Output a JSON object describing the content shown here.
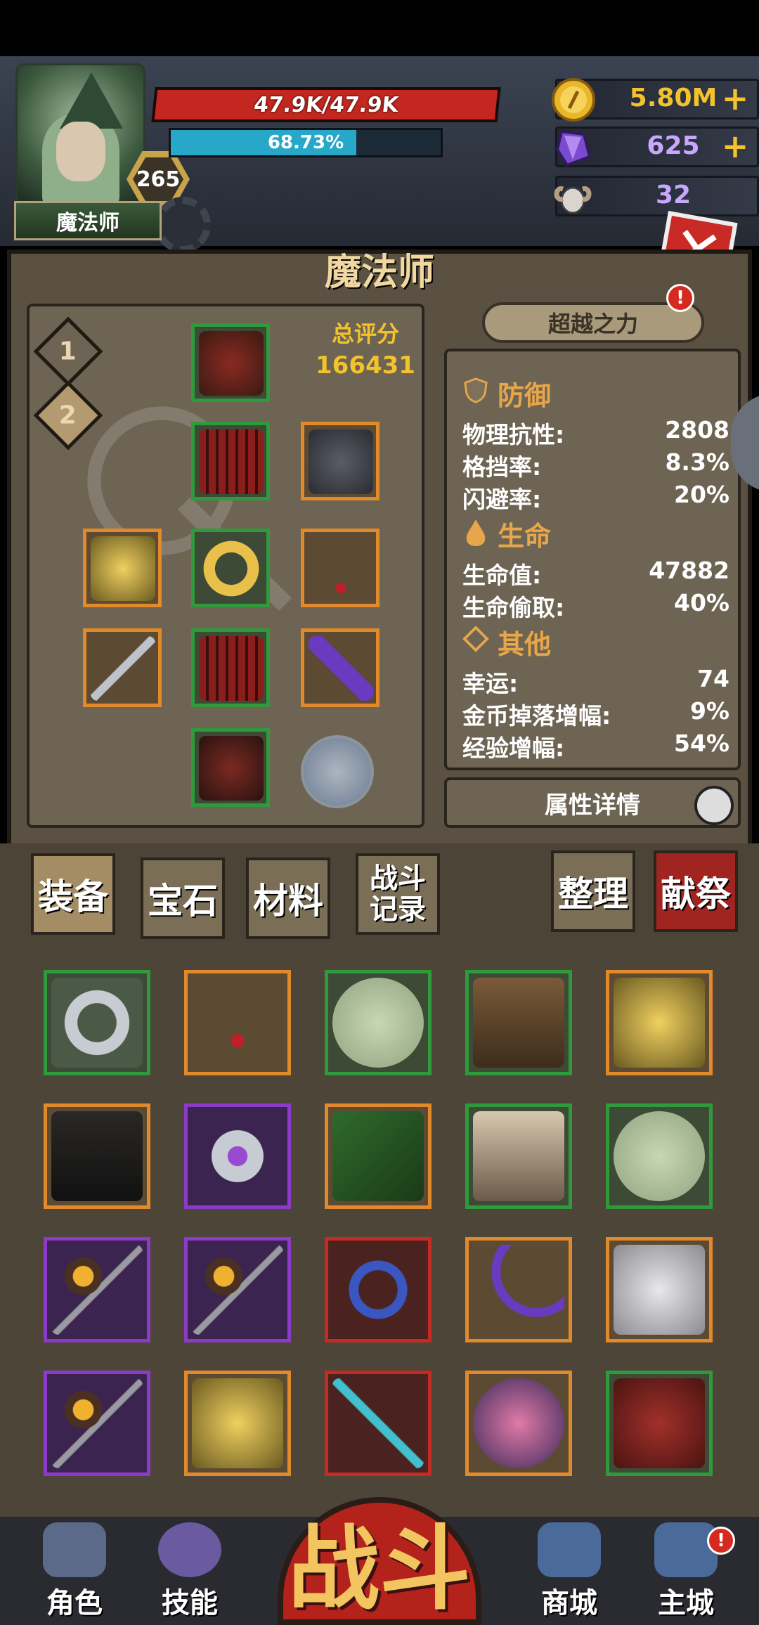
{
  "hero": {
    "class_name": "魔法师",
    "level": "265",
    "hp_text": "47.9K/47.9K",
    "mp_text": "68.73%",
    "mp_fraction": 0.6873
  },
  "currencies": [
    {
      "icon": "gold-coin-icon",
      "value": "5.80M",
      "has_plus": true
    },
    {
      "icon": "purple-crystal-icon",
      "value": "625",
      "has_plus": true
    },
    {
      "icon": "ram-skull-icon",
      "value": "32",
      "has_plus": false
    }
  ],
  "panel": {
    "title": "魔法师",
    "loadout_tabs": [
      "1",
      "2"
    ],
    "score_label": "总评分",
    "score_value": "166431",
    "transcend_label": "超越之力",
    "transcend_badge": "!",
    "detail_button": "属性详情"
  },
  "stats": {
    "defense": {
      "title": "防御",
      "rows": [
        {
          "label": "物理抗性:",
          "value": "2808"
        },
        {
          "label": "格挡率:",
          "value": "8.3%"
        },
        {
          "label": "闪避率:",
          "value": "20%"
        }
      ]
    },
    "life": {
      "title": "生命",
      "rows": [
        {
          "label": "生命值:",
          "value": "47882"
        },
        {
          "label": "生命偷取:",
          "value": "40%"
        }
      ]
    },
    "other": {
      "title": "其他",
      "rows": [
        {
          "label": "幸运:",
          "value": "74"
        },
        {
          "label": "金币掉落增幅:",
          "value": "9%"
        },
        {
          "label": "经验增幅:",
          "value": "54%"
        }
      ]
    }
  },
  "tabs": {
    "equip": "装备",
    "gem": "宝石",
    "material": "材料",
    "battle_log": "战斗记录",
    "sort": "整理",
    "sacrifice": "献祭"
  },
  "bottom_nav": {
    "character": "角色",
    "skills": "技能",
    "battle": "战斗",
    "shop": "商城",
    "main_city": "主城",
    "main_city_badge": "!"
  },
  "colors": {
    "rarity_green": "#2e9a3b",
    "rarity_orange": "#e2892b",
    "rarity_purple": "#8c3bc8",
    "rarity_red": "#c52b22",
    "hp_red": "#c4271f",
    "mp_cyan": "#27a8c8",
    "gold_text": "#f3c22d"
  }
}
